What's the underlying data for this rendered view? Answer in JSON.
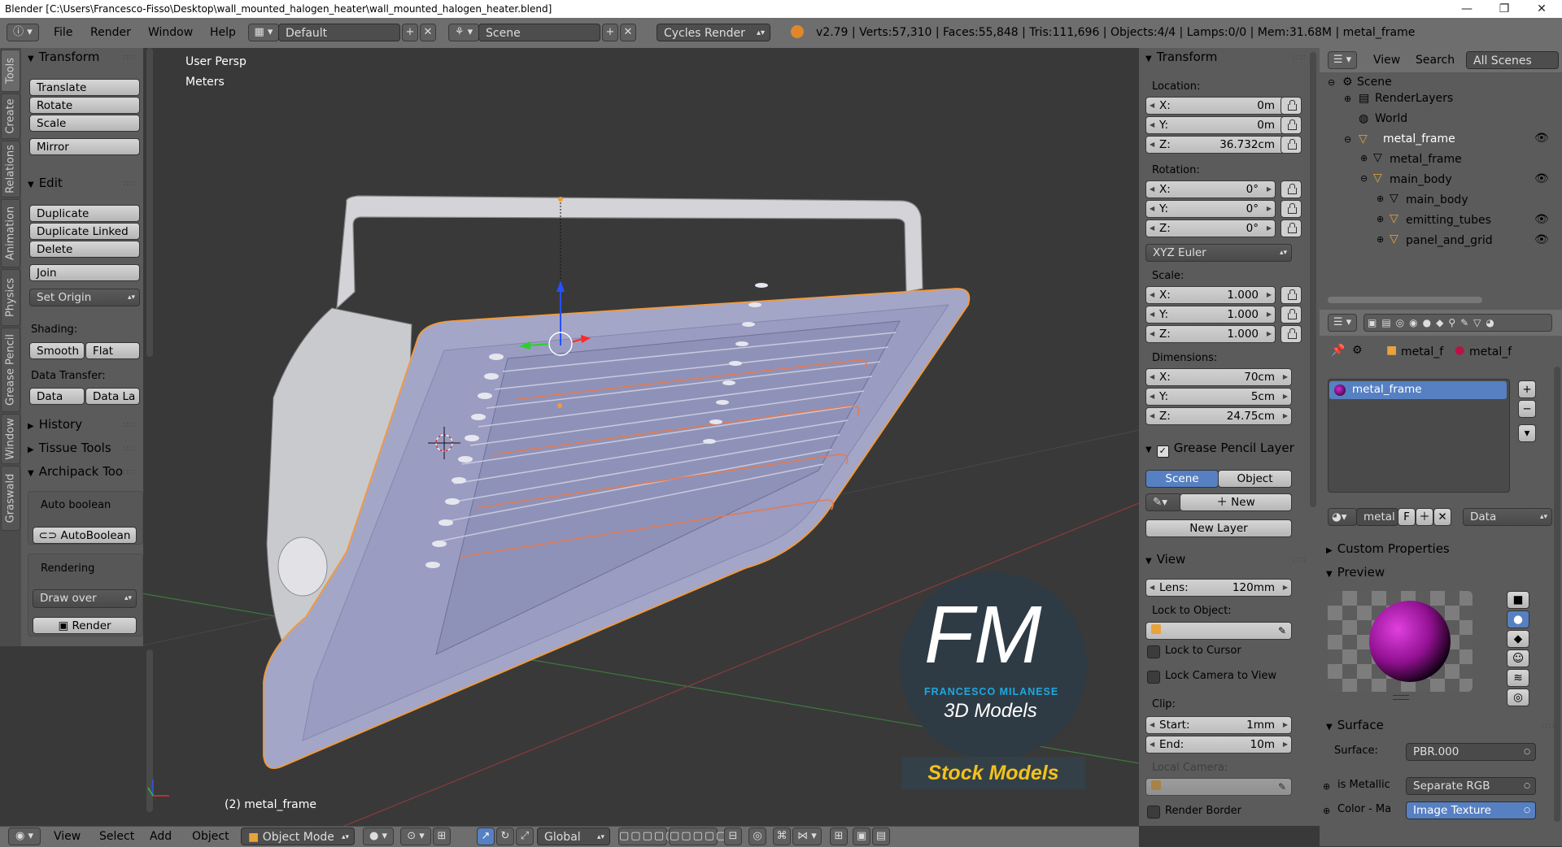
{
  "window": {
    "title": "Blender [C:\\Users\\Francesco-Fisso\\Desktop\\wall_mounted_halogen_heater\\wall_mounted_halogen_heater.blend]",
    "minimize": "—",
    "maximize": "❐",
    "close": "✕"
  },
  "info_header": {
    "menus": [
      "File",
      "Render",
      "Window",
      "Help"
    ],
    "screen_layout": "Default",
    "scene": "Scene",
    "render_engine": "Cycles Render",
    "stats": "v2.79 | Verts:57,310 | Faces:55,848 | Tris:111,696 | Objects:4/4 | Lamps:0/0 | Mem:31.68M | metal_frame"
  },
  "tool_tabs": [
    "Tools",
    "Create",
    "Relations",
    "Animation",
    "Physics",
    "Grease Pencil",
    "Window",
    "Graswald"
  ],
  "toolshelf": {
    "transform": {
      "title": "Transform",
      "buttons": [
        "Translate",
        "Rotate",
        "Scale",
        "Mirror"
      ]
    },
    "edit": {
      "title": "Edit",
      "buttons": [
        "Duplicate",
        "Duplicate Linked",
        "Delete",
        "Join"
      ],
      "set_origin": "Set Origin"
    },
    "shading": {
      "label": "Shading:",
      "smooth": "Smooth",
      "flat": "Flat"
    },
    "data_transfer": {
      "label": "Data Transfer:",
      "data": "Data",
      "data_layers": "Data La"
    },
    "collapsed": [
      "History",
      "Tissue Tools"
    ],
    "archipack": {
      "title": "Archipack Too",
      "auto_boolean_label": "Auto boolean",
      "auto_boolean_btn": "AutoBoolean",
      "rendering_label": "Rendering",
      "draw_over": "Draw over",
      "render_btn": "Render"
    }
  },
  "viewport": {
    "view_name": "User Persp",
    "units": "Meters",
    "object_label": "(2) metal_frame",
    "watermark": {
      "logo": "FM",
      "name": "FRANCESCO MILANESE",
      "subtitle": "3D Models",
      "badge": "Stock Models"
    }
  },
  "npanel": {
    "transform_title": "Transform",
    "location_label": "Location:",
    "location": [
      {
        "k": "X:",
        "v": "0m"
      },
      {
        "k": "Y:",
        "v": "0m"
      },
      {
        "k": "Z:",
        "v": "36.732cm"
      }
    ],
    "rotation_label": "Rotation:",
    "rotation": [
      {
        "k": "X:",
        "v": "0°"
      },
      {
        "k": "Y:",
        "v": "0°"
      },
      {
        "k": "Z:",
        "v": "0°"
      }
    ],
    "rotation_mode": "XYZ Euler",
    "scale_label": "Scale:",
    "scale": [
      {
        "k": "X:",
        "v": "1.000"
      },
      {
        "k": "Y:",
        "v": "1.000"
      },
      {
        "k": "Z:",
        "v": "1.000"
      }
    ],
    "dimensions_label": "Dimensions:",
    "dimensions": [
      {
        "k": "X:",
        "v": "70cm"
      },
      {
        "k": "Y:",
        "v": "5cm"
      },
      {
        "k": "Z:",
        "v": "24.75cm"
      }
    ],
    "grease_pencil_title": "Grease Pencil Layer",
    "gp_scene": "Scene",
    "gp_object": "Object",
    "gp_new": "New",
    "gp_new_layer": "New Layer",
    "view_title": "View",
    "lens": {
      "k": "Lens:",
      "v": "120mm"
    },
    "lock_to_object": "Lock to Object:",
    "lock_to_cursor": "Lock to Cursor",
    "lock_camera": "Lock Camera to View",
    "clip_label": "Clip:",
    "clip_start": {
      "k": "Start:",
      "v": "1mm"
    },
    "clip_end": {
      "k": "End:",
      "v": "10m"
    },
    "local_camera": "Local Camera:",
    "render_border": "Render Border"
  },
  "outliner": {
    "view": "View",
    "search": "Search",
    "all_scenes": "All Scenes",
    "rows": [
      "Scene",
      "RenderLayers",
      "World",
      "metal_frame",
      "metal_frame",
      "main_body",
      "main_body",
      "emitting_tubes",
      "panel_and_grid"
    ]
  },
  "properties": {
    "breadcrumb_a": "metal_f",
    "breadcrumb_b": "metal_f",
    "material_slot": "metal_frame",
    "material_name": "metal",
    "material_f": "F",
    "data_mode": "Data",
    "custom_properties": "Custom Properties",
    "preview": "Preview",
    "surface_title": "Surface",
    "surface_label": "Surface:",
    "surface_value": "PBR.000",
    "is_metallic_label": "is Metallic",
    "is_metallic_value": "Separate RGB",
    "color_label": "Color - Ma",
    "color_value": "Image Texture"
  },
  "bottom_header": {
    "menus": [
      "View",
      "Select",
      "Add",
      "Object"
    ],
    "mode": "Object Mode",
    "orientation": "Global"
  },
  "colors": {
    "accent_blue": "#5680c2",
    "object_outline": "#f39a3a",
    "heater_body": "#a4a6c8",
    "logo_blue": "#1ea8e0",
    "badge_yellow": "#f2c21a"
  }
}
